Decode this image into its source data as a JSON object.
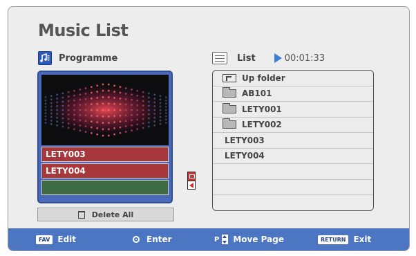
{
  "title": "Music List",
  "programme": {
    "header": "Programme",
    "rows": [
      {
        "label": "LETY003",
        "style": "red"
      },
      {
        "label": "LETY004",
        "style": "red"
      },
      {
        "label": "",
        "style": "green"
      }
    ],
    "delete_label": "Delete All"
  },
  "list": {
    "header": "List",
    "time": "00:01:33",
    "items": [
      {
        "label": "Up folder",
        "kind": "up"
      },
      {
        "label": "AB101",
        "kind": "folder"
      },
      {
        "label": "LETY001",
        "kind": "folder"
      },
      {
        "label": "LETY002",
        "kind": "folder"
      },
      {
        "label": "LETY003",
        "kind": "file"
      },
      {
        "label": "LETY004",
        "kind": "file"
      },
      {
        "label": "",
        "kind": "empty"
      },
      {
        "label": "",
        "kind": "empty"
      },
      {
        "label": "",
        "kind": "empty"
      }
    ]
  },
  "footer": {
    "fav_key": "FAV",
    "edit": "Edit",
    "enter": "Enter",
    "p_key": "P",
    "move_page": "Move Page",
    "return_key": "RETURN",
    "exit": "Exit"
  },
  "colors": {
    "accent_blue": "#4d76c2",
    "programme_red": "#a8373c",
    "programme_green": "#3d6b43",
    "play_icon": "#3b7fd8"
  },
  "icons": [
    "programme-icon",
    "list-icon",
    "play-icon",
    "trash-icon",
    "folder-icon",
    "up-folder-icon",
    "move-icon",
    "enter-icon",
    "page-stepper-icon"
  ]
}
